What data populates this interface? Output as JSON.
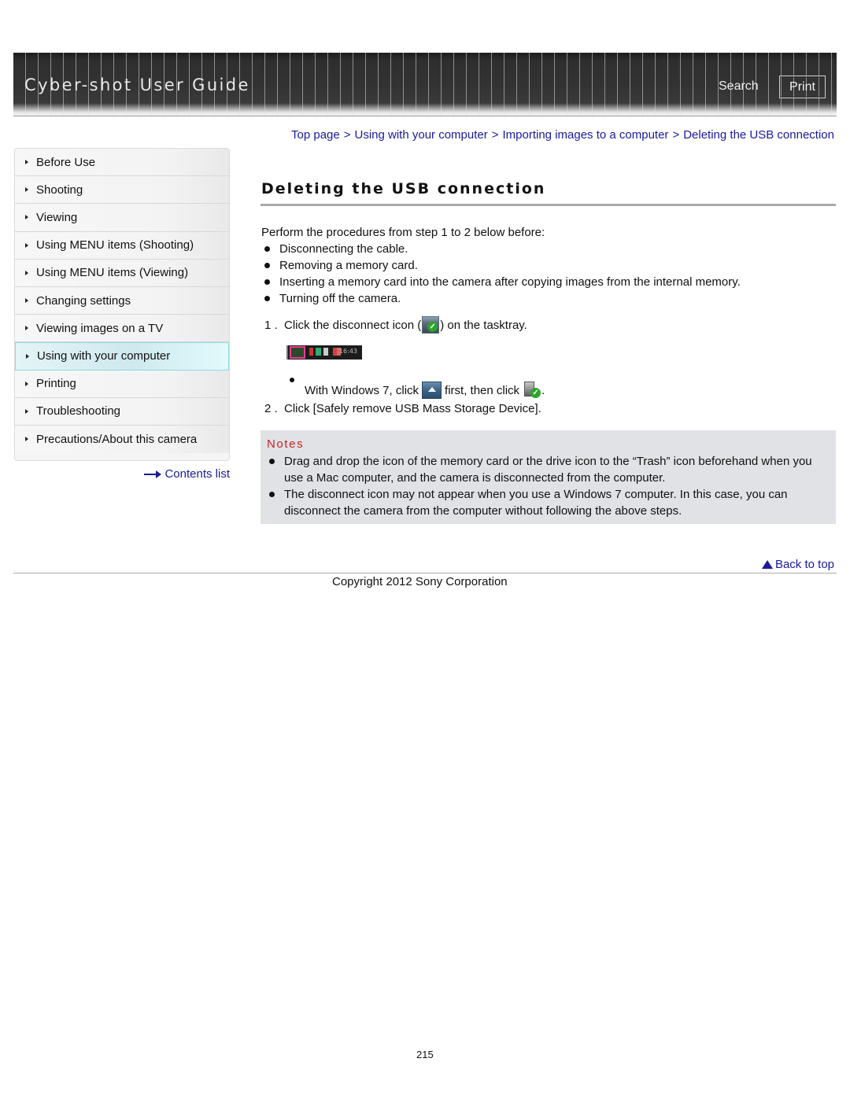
{
  "header": {
    "title": "Cyber-shot User Guide",
    "search_label": "Search",
    "print_label": "Print"
  },
  "breadcrumb": {
    "items": [
      "Top page",
      "Using with your computer",
      "Importing images to a computer",
      "Deleting the USB connection"
    ],
    "separator": ">"
  },
  "sidebar": {
    "items": [
      {
        "label": "Before Use",
        "active": false
      },
      {
        "label": "Shooting",
        "active": false
      },
      {
        "label": "Viewing",
        "active": false
      },
      {
        "label": "Using MENU items (Shooting)",
        "active": false
      },
      {
        "label": "Using MENU items (Viewing)",
        "active": false
      },
      {
        "label": "Changing settings",
        "active": false
      },
      {
        "label": "Viewing images on a TV",
        "active": false
      },
      {
        "label": "Using with your computer",
        "active": true
      },
      {
        "label": "Printing",
        "active": false
      },
      {
        "label": "Troubleshooting",
        "active": false
      },
      {
        "label": "Precautions/About this camera",
        "active": false
      }
    ],
    "contents_link": "Contents list"
  },
  "main": {
    "title": "Deleting the USB connection",
    "intro": "Perform the procedures from step 1  to 2  below before:",
    "bullets": [
      "Disconnecting the cable.",
      "Removing a memory card.",
      "Inserting a memory card into the camera after copying images from the internal memory.",
      "Turning off the camera."
    ],
    "steps": [
      {
        "num": "1 .",
        "before_icon": "Click the disconnect icon (",
        "icon": "disconnect-icon",
        "after_icon": ") on the tasktray."
      },
      {
        "num": "2 .",
        "text": "Click [Safely remove USB Mass Storage Device]."
      }
    ],
    "tasktray_time": "16:43",
    "sub_bullet": {
      "part1": "With Windows 7, click ",
      "icon1": "show-hidden-icons-icon",
      "part2": " first, then click ",
      "icon2": "usb-disconnect-icon",
      "part3": "."
    }
  },
  "notes": {
    "title": "Notes",
    "items": [
      "Drag and drop the icon of the memory card or the drive icon to the “Trash” icon beforehand when you use a Mac computer, and the camera is disconnected from the computer.",
      "The disconnect icon may not appear when you use a Windows 7 computer. In this case, you can disconnect the camera from the computer without following the above steps."
    ]
  },
  "footer": {
    "back_to_top": "Back to top",
    "copyright": "Copyright 2012 Sony Corporation",
    "page_number": "215"
  },
  "colors": {
    "link": "#1a1a9c",
    "notes_title": "#cc2222",
    "notes_bg": "#e0e2e6",
    "active_item_border": "#8fd8ea",
    "tasktray_highlight": "#e93c93"
  }
}
